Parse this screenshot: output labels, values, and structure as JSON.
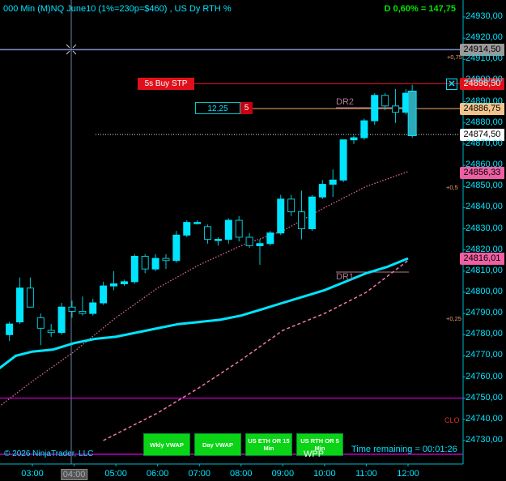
{
  "header": {
    "title": "000 Min (M)NQ June10 (1%=230p=$460) , US Dy RTH %",
    "delta": "D 0,60% = 147,75"
  },
  "copyright": "© 2026 NinjaTrader, LLC",
  "time_remaining": "Time remaining = 00:01:26",
  "order": {
    "buy_stop_label": "5s  Buy STP",
    "qty_label": "12,25",
    "qty_count": "5"
  },
  "chart_labels": {
    "dr2": "DR2",
    "dr1": "DR1",
    "wpp": "WPP",
    "clo": "CLO",
    "pct_075": "+0,75",
    "pct_05": "+0,5",
    "pct_025": "+0,25"
  },
  "buttons": [
    {
      "label": "Wkly VWAP"
    },
    {
      "label": "Day VWAP"
    },
    {
      "label": "US ETH OR 15 Min"
    },
    {
      "label": "US RTH OR 5 Min"
    }
  ],
  "price_tags": [
    {
      "label": "24914,50",
      "bg": "#9a9a9a",
      "fg": "#000000"
    },
    {
      "label": "24898,50",
      "bg": "#e0101b",
      "fg": "#ffffff"
    },
    {
      "label": "24886,75",
      "bg": "#f2c48c",
      "fg": "#000000"
    },
    {
      "label": "24874,50",
      "bg": "#ffffff",
      "fg": "#000000"
    },
    {
      "label": "24856,33",
      "bg": "#ef5fa3",
      "fg": "#000000"
    },
    {
      "label": "24816,01",
      "bg": "#ef5fa3",
      "fg": "#000000"
    }
  ],
  "chart_data": {
    "type": "candlestick",
    "y_ticks": [
      24730,
      24740,
      24750,
      24760,
      24770,
      24780,
      24790,
      24800,
      24810,
      24820,
      24830,
      24840,
      24850,
      24860,
      24870,
      24880,
      24890,
      24900,
      24910,
      24920,
      24930
    ],
    "y_tick_labels": [
      "24730,00",
      "24740,00",
      "24750,00",
      "24760,00",
      "24770,00",
      "24780,00",
      "24790,00",
      "24800,00",
      "24810,00",
      "24820,00",
      "24830,00",
      "24840,00",
      "24850,00",
      "24860,00",
      "24870,00",
      "24880,00",
      "24890,00",
      "24900,00",
      "24910,00",
      "24920,00",
      "24930,00"
    ],
    "x_labels": [
      "03:00",
      "04:00",
      "05:00",
      "06:00",
      "07:00",
      "08:00",
      "09:00",
      "10:00",
      "11:00",
      "12:00"
    ],
    "x_hours": [
      3,
      4,
      5,
      6,
      7,
      8,
      9,
      10,
      11,
      12
    ],
    "highlighted_x_label": "04:00",
    "candles": [
      {
        "t": 2.45,
        "o": 24780,
        "h": 24786,
        "l": 24777,
        "c": 24785
      },
      {
        "t": 2.7,
        "o": 24786,
        "h": 24807,
        "l": 24785,
        "c": 24802
      },
      {
        "t": 2.95,
        "o": 24802,
        "h": 24807,
        "l": 24793,
        "c": 24793
      },
      {
        "t": 3.2,
        "o": 24788,
        "h": 24790,
        "l": 24775,
        "c": 24783
      },
      {
        "t": 3.45,
        "o": 24782,
        "h": 24785,
        "l": 24779,
        "c": 24781
      },
      {
        "t": 3.7,
        "o": 24781,
        "h": 24795,
        "l": 24780,
        "c": 24793
      },
      {
        "t": 3.95,
        "o": 24793,
        "h": 24796,
        "l": 24788,
        "c": 24791
      },
      {
        "t": 4.2,
        "o": 24791,
        "h": 24798,
        "l": 24789,
        "c": 24790
      },
      {
        "t": 4.45,
        "o": 24790,
        "h": 24797,
        "l": 24789,
        "c": 24795
      },
      {
        "t": 4.7,
        "o": 24795,
        "h": 24805,
        "l": 24794,
        "c": 24803
      },
      {
        "t": 4.95,
        "o": 24803,
        "h": 24810,
        "l": 24801,
        "c": 24804
      },
      {
        "t": 5.2,
        "o": 24804,
        "h": 24806,
        "l": 24803,
        "c": 24805
      },
      {
        "t": 5.45,
        "o": 24805,
        "h": 24818,
        "l": 24804,
        "c": 24817
      },
      {
        "t": 5.7,
        "o": 24817,
        "h": 24818,
        "l": 24809,
        "c": 24811
      },
      {
        "t": 5.95,
        "o": 24811,
        "h": 24818,
        "l": 24810,
        "c": 24816
      },
      {
        "t": 6.2,
        "o": 24816,
        "h": 24818,
        "l": 24811,
        "c": 24815
      },
      {
        "t": 6.45,
        "o": 24815,
        "h": 24829,
        "l": 24814,
        "c": 24827
      },
      {
        "t": 6.7,
        "o": 24827,
        "h": 24834,
        "l": 24826,
        "c": 24833
      },
      {
        "t": 6.95,
        "o": 24833,
        "h": 24834,
        "l": 24832,
        "c": 24833
      },
      {
        "t": 7.2,
        "o": 24831,
        "h": 24832,
        "l": 24823,
        "c": 24825
      },
      {
        "t": 7.45,
        "o": 24825,
        "h": 24826,
        "l": 24822,
        "c": 24825
      },
      {
        "t": 7.7,
        "o": 24825,
        "h": 24835,
        "l": 24823,
        "c": 24834
      },
      {
        "t": 7.95,
        "o": 24834,
        "h": 24836,
        "l": 24824,
        "c": 24826
      },
      {
        "t": 8.2,
        "o": 24826,
        "h": 24828,
        "l": 24821,
        "c": 24822
      },
      {
        "t": 8.45,
        "o": 24822,
        "h": 24825,
        "l": 24813,
        "c": 24823
      },
      {
        "t": 8.7,
        "o": 24823,
        "h": 24829,
        "l": 24822,
        "c": 24828
      },
      {
        "t": 8.95,
        "o": 24828,
        "h": 24846,
        "l": 24827,
        "c": 24844
      },
      {
        "t": 9.2,
        "o": 24844,
        "h": 24846,
        "l": 24836,
        "c": 24838
      },
      {
        "t": 9.45,
        "o": 24838,
        "h": 24848,
        "l": 24825,
        "c": 24830
      },
      {
        "t": 9.7,
        "o": 24830,
        "h": 24846,
        "l": 24829,
        "c": 24845
      },
      {
        "t": 9.95,
        "o": 24845,
        "h": 24853,
        "l": 24844,
        "c": 24851
      },
      {
        "t": 10.2,
        "o": 24851,
        "h": 24858,
        "l": 24845,
        "c": 24853
      },
      {
        "t": 10.45,
        "o": 24853,
        "h": 24872,
        "l": 24852,
        "c": 24872
      },
      {
        "t": 10.7,
        "o": 24872,
        "h": 24874,
        "l": 24870,
        "c": 24873
      },
      {
        "t": 10.95,
        "o": 24873,
        "h": 24882,
        "l": 24872,
        "c": 24881
      },
      {
        "t": 11.2,
        "o": 24881,
        "h": 24894,
        "l": 24879,
        "c": 24893
      },
      {
        "t": 11.45,
        "o": 24893,
        "h": 24894,
        "l": 24886,
        "c": 24888
      },
      {
        "t": 11.7,
        "o": 24888,
        "h": 24896,
        "l": 24880,
        "c": 24885
      },
      {
        "t": 11.95,
        "o": 24885,
        "h": 24896,
        "l": 24884,
        "c": 24894
      },
      {
        "t": 12.1,
        "o": 24895,
        "h": 24898,
        "l": 24873,
        "c": 24874
      }
    ],
    "lines": {
      "solid_cyan_ma": [
        [
          2.2,
          24764
        ],
        [
          2.6,
          24770
        ],
        [
          3,
          24772
        ],
        [
          3.5,
          24773
        ],
        [
          4,
          24776
        ],
        [
          4.5,
          24778
        ],
        [
          5,
          24779
        ],
        [
          5.5,
          24781
        ],
        [
          6,
          24783
        ],
        [
          6.5,
          24785
        ],
        [
          7,
          24786
        ],
        [
          7.5,
          24787
        ],
        [
          8,
          24789
        ],
        [
          8.5,
          24792
        ],
        [
          9,
          24795
        ],
        [
          9.5,
          24798
        ],
        [
          10,
          24801
        ],
        [
          10.5,
          24805
        ],
        [
          11,
          24809
        ],
        [
          11.5,
          24812
        ],
        [
          12,
          24816
        ]
      ],
      "dotted_pink_ma": [
        [
          2.2,
          24746
        ],
        [
          3,
          24758
        ],
        [
          4,
          24772
        ],
        [
          5,
          24788
        ],
        [
          6,
          24802
        ],
        [
          7,
          24813
        ],
        [
          8,
          24822
        ],
        [
          9,
          24829
        ],
        [
          10,
          24840
        ],
        [
          11,
          24850
        ],
        [
          12,
          24857
        ]
      ],
      "dashed_pink_line": [
        [
          4.7,
          24730
        ],
        [
          6,
          24743
        ],
        [
          7,
          24755
        ],
        [
          8,
          24768
        ],
        [
          9,
          24782
        ],
        [
          10,
          24790
        ],
        [
          11,
          24800
        ],
        [
          12,
          24815
        ]
      ]
    },
    "horizontal_levels": [
      {
        "y": 24914.5,
        "color": "#8888cc",
        "style": "solid"
      },
      {
        "y": 24898.5,
        "color": "#c0101b",
        "style": "solid"
      },
      {
        "y": 24886.75,
        "color": "#c88a50",
        "style": "solid"
      },
      {
        "y": 24874.5,
        "color": "#dddddd",
        "style": "dotted"
      },
      {
        "y": 24750,
        "color": "#e000e0",
        "style": "solid"
      },
      {
        "y": 24725,
        "color": "#e000e0",
        "style": "solid"
      }
    ],
    "ylim": [
      24724,
      24937
    ]
  }
}
